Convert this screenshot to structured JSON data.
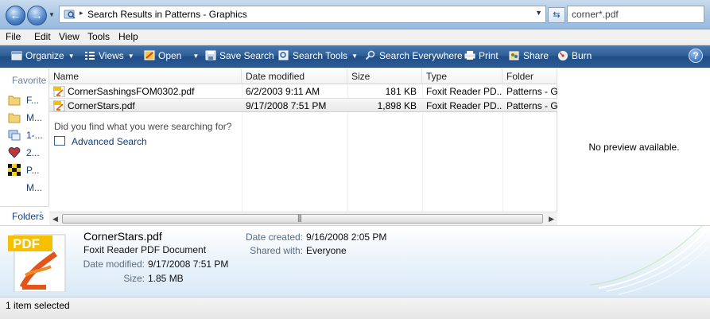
{
  "address": {
    "path_icon": "search-folder-icon",
    "text": "Search Results in Patterns - Graphics"
  },
  "search": {
    "value": "corner*.pdf"
  },
  "menu": [
    "File",
    "Edit",
    "View",
    "Tools",
    "Help"
  ],
  "toolbar": {
    "organize": "Organize",
    "views": "Views",
    "open": "Open",
    "save_search": "Save Search",
    "search_tools": "Search Tools",
    "search_everywhere": "Search Everywhere",
    "print": "Print",
    "share": "Share",
    "burn": "Burn",
    "help": "?"
  },
  "leftnav": {
    "header": "Favorite Links",
    "items": [
      {
        "label": "F...",
        "icon": "folder-icon"
      },
      {
        "label": "M...",
        "icon": "folder-icon"
      },
      {
        "label": "1-...",
        "icon": "image-folder-icon"
      },
      {
        "label": "2...",
        "icon": "heart-icon"
      },
      {
        "label": "P...",
        "icon": "quilt-pattern-icon"
      },
      {
        "label": "M...",
        "icon": "none"
      }
    ],
    "folders": "Folders"
  },
  "columns": [
    "Name",
    "Date modified",
    "Size",
    "Type",
    "Folder"
  ],
  "files": [
    {
      "name": "CornerSashingsFOM0302.pdf",
      "date": "6/2/2003 9:11 AM",
      "size": "181 KB",
      "type": "Foxit Reader PD...",
      "folder": "Patterns - G...",
      "selected": false
    },
    {
      "name": "CornerStars.pdf",
      "date": "9/17/2008 7:51 PM",
      "size": "1,898 KB",
      "type": "Foxit Reader PD...",
      "folder": "Patterns - G...",
      "selected": true
    }
  ],
  "find_prompt": "Did you find what you were searching for?",
  "advanced_search": "Advanced Search",
  "preview": {
    "text": "No preview available."
  },
  "details": {
    "name": "CornerStars.pdf",
    "type": "Foxit Reader PDF Document",
    "icon_badge": "PDF",
    "date_modified_label": "Date modified:",
    "date_modified": "9/17/2008 7:51 PM",
    "size_label": "Size:",
    "size": "1.85 MB",
    "date_created_label": "Date created:",
    "date_created": "9/16/2008 2:05 PM",
    "shared_label": "Shared with:",
    "shared": "Everyone"
  },
  "status": {
    "text": "1 item selected"
  },
  "colors": {
    "toolbar": "#2e5e97",
    "accent": "#16407a",
    "pdf_badge": "#f5c000"
  }
}
